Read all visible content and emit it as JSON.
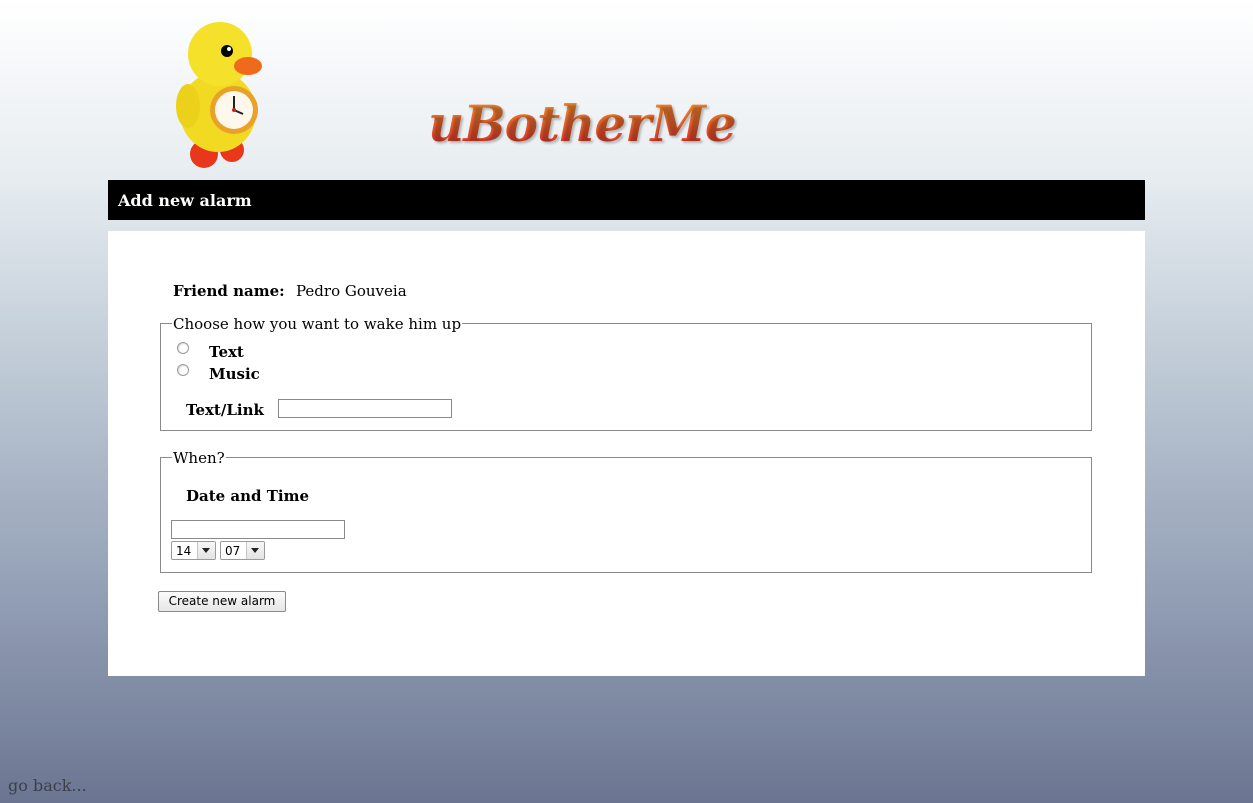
{
  "logo": {
    "text": "uBotherMe",
    "mascot": "duck-alarm-clock-mascot",
    "colors": {
      "duck_yellow": "#f5e12a",
      "beak": "#f06a1c",
      "text_top": "#f19a2f",
      "text_bottom": "#d8262a"
    }
  },
  "header": {
    "title": "Add new alarm"
  },
  "form": {
    "friend_label": "Friend name:",
    "friend_value": "Pedro Gouveia",
    "wake": {
      "legend": "Choose how you want to wake him up",
      "options": [
        "Text",
        "Music"
      ],
      "text_link_label": "Text/Link",
      "text_link_value": ""
    },
    "when": {
      "legend": "When?",
      "date_time_label": "Date and Time",
      "date_value": "",
      "hour": "14",
      "minute": "07"
    },
    "submit_label": "Create new alarm"
  },
  "footer": {
    "go_back": "go back..."
  },
  "colors": {
    "title_bar": "#000000",
    "panel": "#ffffff",
    "background_top": "#ffffff",
    "background_bottom": "#6b7591"
  }
}
